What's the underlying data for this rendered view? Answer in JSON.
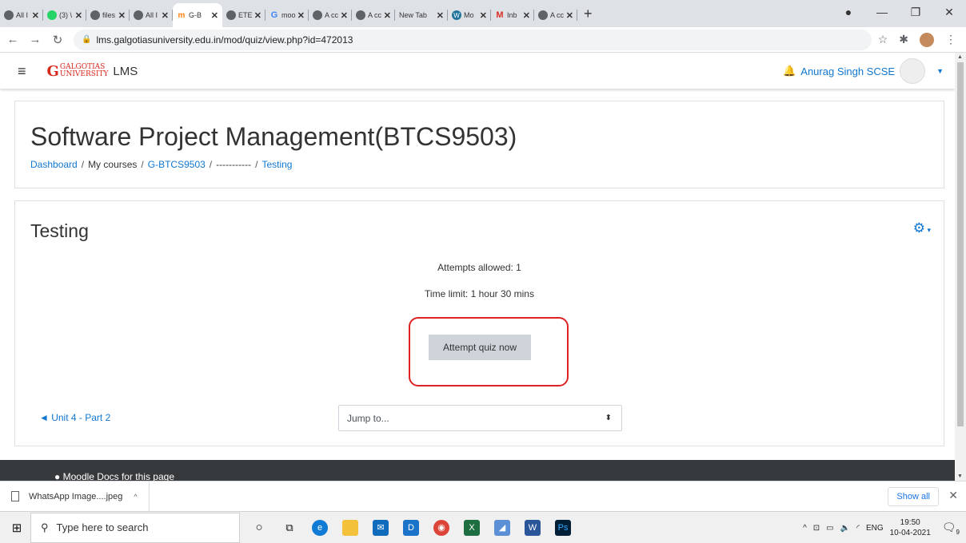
{
  "browser": {
    "tabs": [
      {
        "title": "All I",
        "icon": "globe-icon"
      },
      {
        "title": "(3) \\",
        "icon": "green-chat-icon"
      },
      {
        "title": "files",
        "icon": "globe-icon"
      },
      {
        "title": "All I",
        "icon": "globe-icon"
      },
      {
        "title": "G-B",
        "icon": "moodle-icon",
        "active": true
      },
      {
        "title": "ETE",
        "icon": "globe-icon"
      },
      {
        "title": "moo",
        "icon": "google-icon"
      },
      {
        "title": "A cc",
        "icon": "globe-icon"
      },
      {
        "title": "A cc",
        "icon": "globe-icon"
      },
      {
        "title": "New Tab",
        "icon": "none"
      },
      {
        "title": "Mo",
        "icon": "wordpress-icon"
      },
      {
        "title": "Inb",
        "icon": "gmail-icon"
      },
      {
        "title": "A cc",
        "icon": "globe-icon"
      }
    ],
    "new_tab": "+",
    "url": "lms.galgotiasuniversity.edu.in/mod/quiz/view.php?id=472013"
  },
  "moodle": {
    "logo_main": "GALGOTIAS",
    "logo_sub": "UNIVERSITY",
    "logo_suffix": "LMS",
    "user_name": "Anurag Singh SCSE"
  },
  "course": {
    "title": "Software Project Management(BTCS9503)",
    "breadcrumb": [
      {
        "label": "Dashboard",
        "link": true
      },
      {
        "label": "My courses",
        "link": false
      },
      {
        "label": "G-BTCS9503",
        "link": true
      },
      {
        "label": "-----------",
        "link": false
      },
      {
        "label": "Testing",
        "link": true
      }
    ]
  },
  "quiz": {
    "title": "Testing",
    "attempts_allowed": "Attempts allowed: 1",
    "time_limit": "Time limit: 1 hour 30 mins",
    "attempt_button": "Attempt quiz now",
    "prev_activity": "◄ Unit 4 - Part 2",
    "jump_placeholder": "Jump to..."
  },
  "footer": {
    "text": "Moodle Docs for this page"
  },
  "downloads": {
    "file": "WhatsApp Image....jpeg",
    "show_all": "Show all"
  },
  "taskbar": {
    "search_placeholder": "Type here to search",
    "lang": "ENG",
    "time": "19:50",
    "date": "10-04-2021",
    "notifications": "9"
  },
  "colors": {
    "accent": "#1177d1",
    "highlight": "#dd2222",
    "footer": "#373a3c"
  }
}
